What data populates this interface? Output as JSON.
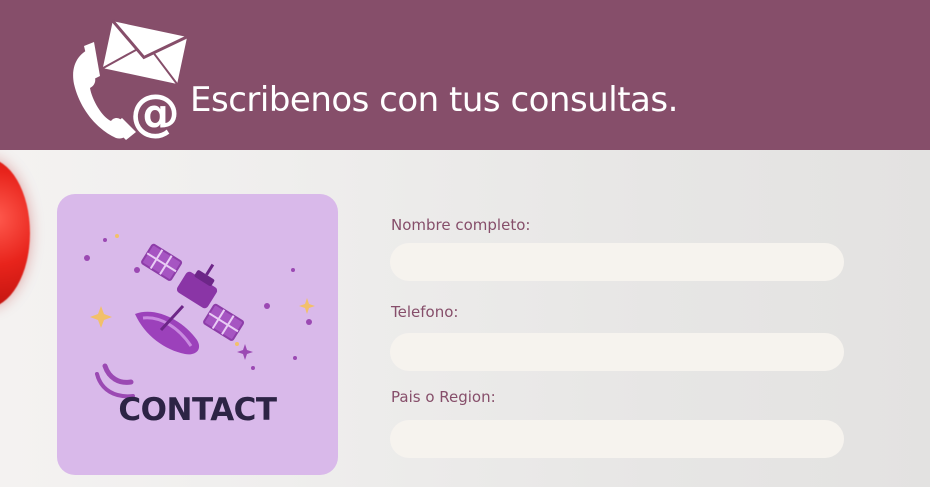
{
  "header": {
    "title": "Escribenos con tus consultas.",
    "icon": "phone-mail-at-icon",
    "background_color": "#864e6a"
  },
  "contact_card": {
    "label": "CONTACT",
    "art": "satellite-illustration",
    "background_color": "#d9b9ea"
  },
  "form": {
    "fields": [
      {
        "label": "Nombre completo:",
        "value": "",
        "placeholder": ""
      },
      {
        "label": "Telefono:",
        "value": "",
        "placeholder": ""
      },
      {
        "label": "Pais o Region:",
        "value": "",
        "placeholder": ""
      }
    ],
    "label_color": "#864e6a",
    "input_color": "#f6f3ee"
  }
}
